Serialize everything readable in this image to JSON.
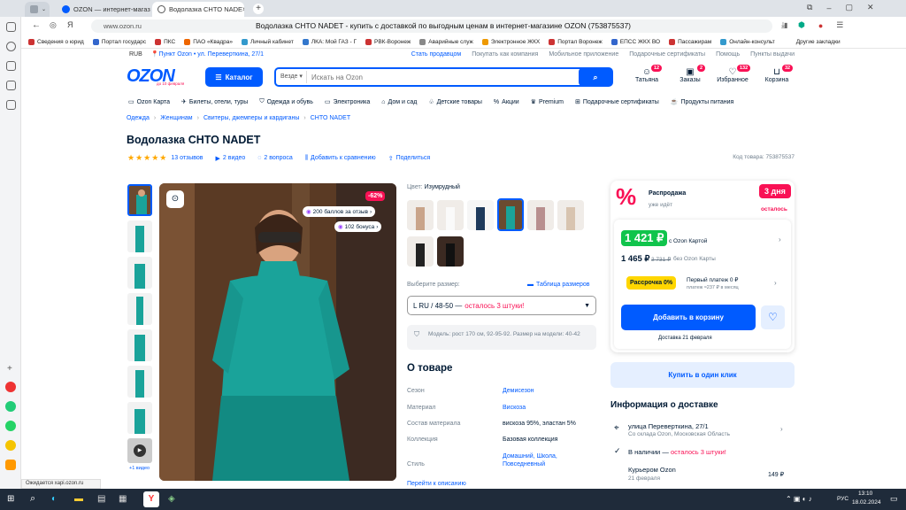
{
  "browser": {
    "tabs": [
      {
        "label": "",
        "type": "tabs-overview"
      },
      {
        "label": "OZON — интернет-магазин"
      },
      {
        "label": "Водолазка CHTO NADE"
      }
    ],
    "address_host": "www.ozon.ru",
    "address_title": "Водолазка CHTO NADET - купить с доставкой по выгодным ценам в интернет-магазине OZON (753875537)",
    "bookmarks": [
      "Сведения о юрид",
      "Портал государс",
      "ПКС",
      "ПАО «Квадра»",
      "Личный кабинет",
      "ЛКА: Мой ГАЗ - Г",
      "РВК-Воронеж",
      "Аварийные служ",
      "Электронное ЖКХ",
      "Портал Воронеж",
      "ЕПСС ЖКХ ВО",
      "Пассажирам",
      "Онлайн-консульт"
    ],
    "other_bookmarks": "Другие закладки",
    "status_text": "Ожидается xapi.ozon.ru"
  },
  "topbar": {
    "currency": "RUB",
    "pickup": "Пункт Ozon • ул. Переверткина, 27/1",
    "links": [
      "Стать продавцом",
      "Покупать как компания",
      "Мобильное приложение",
      "Подарочные сертификаты",
      "Помощь",
      "Пункты выдачи"
    ]
  },
  "header": {
    "logo": "OZON",
    "logo_sub": "до 10 февраля",
    "catalog": "Каталог",
    "search_scope": "Везде",
    "search_placeholder": "Искать на Ozon",
    "actions": [
      {
        "label": "Татьяна",
        "badge": "12"
      },
      {
        "label": "Заказы",
        "badge": "2"
      },
      {
        "label": "Избранное",
        "badge": "132"
      },
      {
        "label": "Корзина",
        "badge": "32"
      }
    ]
  },
  "nav": [
    "Ozon Карта",
    "Билеты, отели, туры",
    "Одежда и обувь",
    "Электроника",
    "Дом и сад",
    "Детские товары",
    "Акции",
    "Premium",
    "Подарочные сертификаты",
    "Продукты питания"
  ],
  "breadcrumbs": [
    "Одежда",
    "Женщинам",
    "Свитеры, джемперы и кардиганы",
    "CHTO NADET"
  ],
  "product": {
    "title": "Водолазка CHTO NADET",
    "reviews": "13 отзывов",
    "videos": "2 видео",
    "questions": "2 вопроса",
    "compare": "Добавить к сравнению",
    "share": "Поделиться",
    "code": "Код товара: 753875537",
    "rating": 5,
    "discount": "-62%",
    "points": "200 баллов за отзыв",
    "bonus": "102 бонуса",
    "video_thumb_label": "+1 видео"
  },
  "variants": {
    "color_label": "Цвет: ",
    "color_value": "Изумрудный",
    "size_label": "Выберите размер:",
    "size_table": "Таблица размеров",
    "size_value": "L RU / 48-50 —",
    "size_stock": "осталось 3 штуки!",
    "model_info": "Модель: рост 170 см, 92-95-92. Размер на модели: 40-42"
  },
  "about": {
    "title": "О товаре",
    "rows": [
      {
        "k": "Сезон",
        "v": "Демисезон",
        "link": true
      },
      {
        "k": "Материал",
        "v": "Вискоза",
        "link": true
      },
      {
        "k": "Состав материала",
        "v": "вискоза 95%, эластан 5%",
        "link": false
      },
      {
        "k": "Коллекция",
        "v": "Базовая коллекция",
        "link": false
      },
      {
        "k": "Стиль",
        "v": "Домашний, Школа, Повседневный",
        "link": true
      }
    ],
    "more": "Перейти к описанию"
  },
  "sale": {
    "title": "Распродажа",
    "subtitle": "уже идёт",
    "days": "3 дня",
    "days_sub": "осталось",
    "price_card": "1 421 ₽",
    "price_card_label": "с Ozon Картой",
    "price": "1 465 ₽",
    "price_old": "3 731 ₽",
    "price_label": "без Ozon Карты",
    "installment_badge": "Рассрочка 0%",
    "installment_title": "Первый платеж 0 ₽",
    "installment_sub": "платеж ≈237 ₽ в месяц",
    "add_to_cart": "Добавить в корзину",
    "delivery": "Доставка 21 февраля",
    "one_click": "Купить в один клик"
  },
  "delivery": {
    "title": "Информация о доставке",
    "address": "улица Переверткина, 27/1",
    "address_sub": "Со склада Ozon, Московская Область",
    "stock_label": "В наличии —",
    "stock_value": "осталось 3 штуки!",
    "courier": "Курьером Ozon",
    "courier_date": "21 февраля",
    "courier_price": "149 ₽"
  },
  "taskbar": {
    "lang": "РУС",
    "time": "13:10",
    "date": "18.02.2024"
  },
  "colors": {
    "brand": "#005bff",
    "accent": "#f91155",
    "green": "#10c44c",
    "teal": "#1aa39a"
  }
}
